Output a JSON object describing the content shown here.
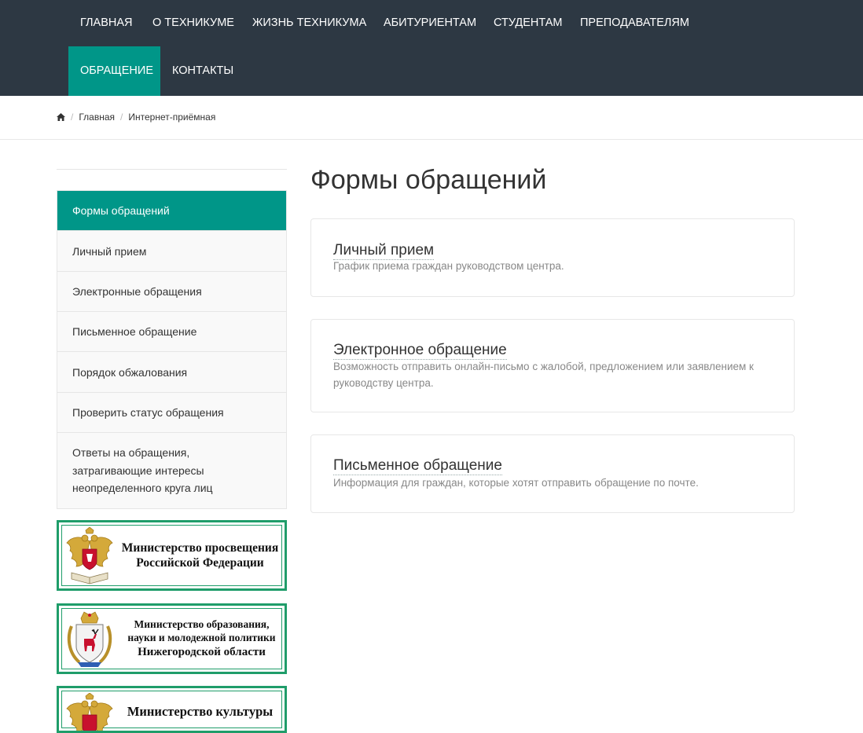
{
  "nav": {
    "items": [
      {
        "label": "ГЛАВНАЯ"
      },
      {
        "label": "О ТЕХНИКУМЕ"
      },
      {
        "label": "ЖИЗНЬ ТЕХНИКУМА"
      },
      {
        "label": "АБИТУРИЕНТАМ"
      },
      {
        "label": "СТУДЕНТАМ"
      },
      {
        "label": "ПРЕПОДАВАТЕЛЯМ"
      },
      {
        "label": "ОБРАЩЕНИЕ"
      },
      {
        "label": "КОНТАКТЫ"
      }
    ],
    "active": "ОБРАЩЕНИЕ"
  },
  "breadcrumb": {
    "home_icon": "home-icon",
    "items": [
      "Главная",
      "Интернет-приёмная"
    ]
  },
  "sidebar": {
    "items": [
      {
        "label": "Формы обращений"
      },
      {
        "label": "Личный прием"
      },
      {
        "label": "Электронные обращения"
      },
      {
        "label": "Письменное обращение"
      },
      {
        "label": "Порядок обжалования"
      },
      {
        "label": "Проверить статус обращения"
      },
      {
        "label": "Ответы на обращения, затрагивающие интересы неопределенного круга лиц"
      }
    ],
    "active": "Формы обращений"
  },
  "banners": [
    {
      "line1": "Министерство просвещения",
      "line2": "Российской Федерации",
      "emblem": "russia-coat-of-arms-icon"
    },
    {
      "line1": "Министерство образования,",
      "line2": "науки и молодежной политики",
      "line3": "Нижегородской области",
      "emblem": "nizhny-novgorod-coat-of-arms-icon"
    },
    {
      "line1": "Министерство культуры",
      "emblem": "russia-coat-of-arms-icon"
    }
  ],
  "main": {
    "title": "Формы обращений",
    "cards": [
      {
        "title": "Личный прием",
        "desc": "График приема граждан руководством центра."
      },
      {
        "title": "Электронное обращение",
        "desc": "Возможность отправить онлайн-письмо с жалобой, предложением или заявлением к руководству центра."
      },
      {
        "title": "Письменное обращение",
        "desc": "Информация для граждан, которые хотят отправить обращение по почте."
      }
    ]
  },
  "colors": {
    "nav_bg": "#2d3843",
    "accent": "#009688",
    "banner_border": "#1f9d6a"
  }
}
